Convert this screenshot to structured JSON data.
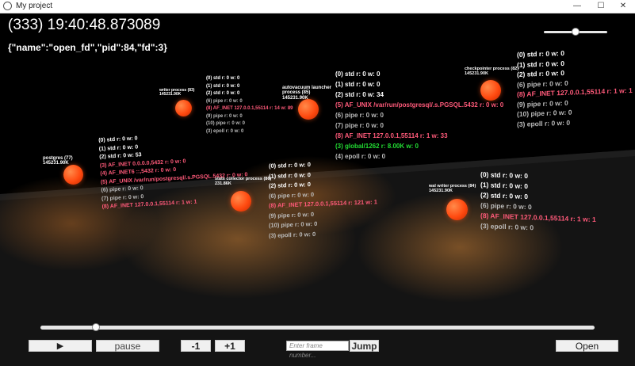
{
  "window": {
    "title": "My project",
    "minimize": "—",
    "maximize": "☐",
    "close": "✕"
  },
  "header": {
    "time": "(333) 19:40:48.873089",
    "event": "{\"name\":\"open_fd\",\"pid\":84,\"fd\":3}"
  },
  "zoom_slider": {
    "value": 0.5
  },
  "timeline_slider": {
    "value": 0.1
  },
  "controls": {
    "play": "▶",
    "pause": "pause",
    "minus": "-1",
    "plus": "+1",
    "frame_placeholder": "Enter frame number...",
    "jump": "Jump",
    "open": "Open"
  },
  "colors": {
    "ball": "#ff4a10",
    "inet": "#ff5a7a",
    "global": "#22dd33",
    "muted": "#bbbbbb"
  },
  "processes": [
    {
      "id": "postgres",
      "label": "postgres (77)",
      "mem": "145231.90K",
      "fds": [
        {
          "t": "(0) std r: 0 w: 0",
          "k": "std"
        },
        {
          "t": "(1) std r: 0 w: 0",
          "k": "std"
        },
        {
          "t": "(2) std r: 0 w: 53",
          "k": "std"
        },
        {
          "t": "(3) AF_INET 0.0.0.0,5432 r: 0 w: 0",
          "k": "inet"
        },
        {
          "t": "(4) AF_INET6 ::,5432 r: 0 w: 0",
          "k": "inet"
        },
        {
          "t": "(5) AF_UNIX /var/run/postgresql/.s.PGSQL.5432 r: 0 w: 0",
          "k": "unix"
        },
        {
          "t": "(6) pipe r: 0 w: 0",
          "k": "pipe"
        },
        {
          "t": "(7) pipe r: 0 w: 0",
          "k": "pipe"
        },
        {
          "t": "(8) AF_INET 127.0.0.1,55114 r: 1 w: 1",
          "k": "inet"
        }
      ]
    },
    {
      "id": "writer",
      "label": "writer process (83)",
      "mem": "145231.90K",
      "fds": [
        {
          "t": "(0) std r: 0 w: 0",
          "k": "std"
        },
        {
          "t": "(1) std r: 0 w: 0",
          "k": "std"
        },
        {
          "t": "(2) std r: 0 w: 0",
          "k": "std"
        },
        {
          "t": "(6) pipe r: 0 w: 0",
          "k": "pipe"
        },
        {
          "t": "(8) AF_INET 127.0.0.1,55114 r: 14 w: 89",
          "k": "inet"
        },
        {
          "t": "(9) pipe r: 0 w: 0",
          "k": "pipe"
        },
        {
          "t": "(10) pipe r: 0 w: 0",
          "k": "pipe"
        },
        {
          "t": "(3) epoll r: 0 w: 0",
          "k": "epoll"
        }
      ]
    },
    {
      "id": "autovacuum",
      "label": "autovacuum launcher process (85)",
      "mem": "145231.90K",
      "fds": [
        {
          "t": "(0) std r: 0 w: 0",
          "k": "std"
        },
        {
          "t": "(1) std r: 0 w: 0",
          "k": "std"
        },
        {
          "t": "(2) std r: 0 w: 34",
          "k": "std"
        },
        {
          "t": "(5) AF_UNIX /var/run/postgresql/.s.PGSQL.5432 r: 0 w: 0",
          "k": "unix"
        },
        {
          "t": "(6) pipe r: 0 w: 0",
          "k": "pipe"
        },
        {
          "t": "(7) pipe r: 0 w: 0",
          "k": "pipe"
        },
        {
          "t": "(8) AF_INET 127.0.0.1,55114 r: 1 w: 33",
          "k": "inet"
        },
        {
          "t": "(3) global/1262 r: 8.00K w: 0",
          "k": "global"
        },
        {
          "t": "(4) epoll r: 0 w: 0",
          "k": "epoll"
        }
      ]
    },
    {
      "id": "checkpointer",
      "label": "checkpointer process (82)",
      "mem": "145231.90K",
      "fds": [
        {
          "t": "(0) std r: 0 w: 0",
          "k": "std"
        },
        {
          "t": "(1) std r: 0 w: 0",
          "k": "std"
        },
        {
          "t": "(2) std r: 0 w: 0",
          "k": "std"
        },
        {
          "t": "(6) pipe r: 0 w: 0",
          "k": "pipe"
        },
        {
          "t": "(8) AF_INET 127.0.0.1,55114 r: 1 w: 1",
          "k": "inet"
        },
        {
          "t": "(9) pipe r: 0 w: 0",
          "k": "pipe"
        },
        {
          "t": "(10) pipe r: 0 w: 0",
          "k": "pipe"
        },
        {
          "t": "(3) epoll r: 0 w: 0",
          "k": "epoll"
        }
      ]
    },
    {
      "id": "stats",
      "label": "stats collector process (86)",
      "mem": "231.86K",
      "fds": [
        {
          "t": "(0) std r: 0 w: 0",
          "k": "std"
        },
        {
          "t": "(1) std r: 0 w: 0",
          "k": "std"
        },
        {
          "t": "(2) std r: 0 w: 0",
          "k": "std"
        },
        {
          "t": "(6) pipe r: 0 w: 0",
          "k": "pipe"
        },
        {
          "t": "(8) AF_INET 127.0.0.1,55114 r: 121 w: 1",
          "k": "inet"
        },
        {
          "t": "(9) pipe r: 0 w: 0",
          "k": "pipe"
        },
        {
          "t": "(10) pipe r: 0 w: 0",
          "k": "pipe"
        },
        {
          "t": "(3) epoll r: 0 w: 0",
          "k": "epoll"
        }
      ]
    },
    {
      "id": "walwriter",
      "label": "wal writer process (84)",
      "mem": "145231.90K",
      "fds": [
        {
          "t": "(0) std r: 0 w: 0",
          "k": "std"
        },
        {
          "t": "(1) std r: 0 w: 0",
          "k": "std"
        },
        {
          "t": "(2) std r: 0 w: 0",
          "k": "std"
        },
        {
          "t": "(6) pipe r: 0 w: 0",
          "k": "pipe"
        },
        {
          "t": "(8) AF_INET 127.0.0.1,55114 r: 1 w: 1",
          "k": "inet"
        },
        {
          "t": "(3) epoll r: 0 w: 0",
          "k": "epoll"
        }
      ]
    }
  ]
}
